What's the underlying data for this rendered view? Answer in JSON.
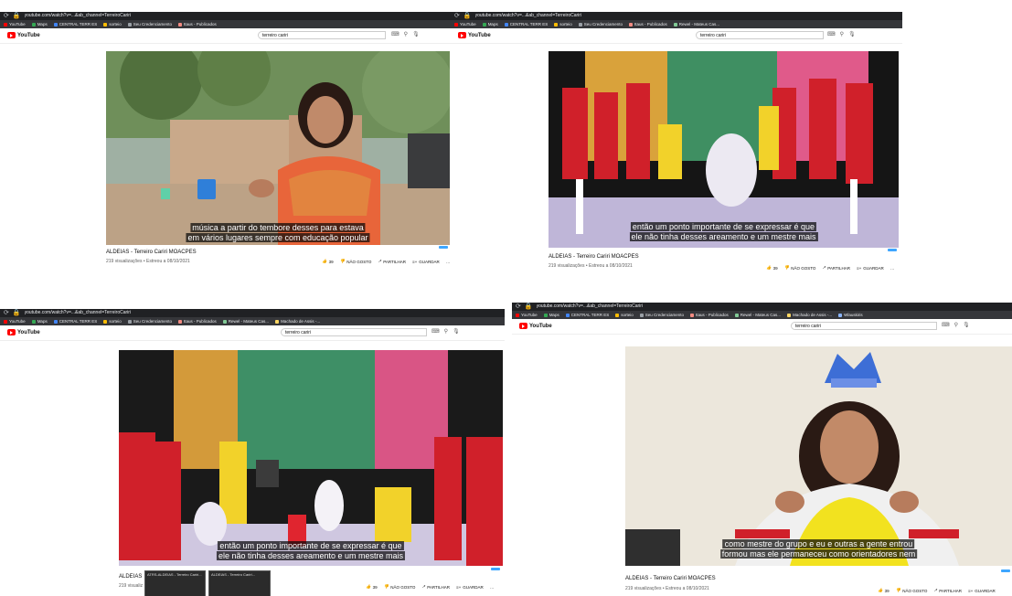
{
  "browser": {
    "url": "youtube.com/watch?v=...&ab_channel=TerreiroCariri",
    "bookmarks": [
      "YouTube",
      "Maps",
      "CENTRAL TERR ES",
      "sorteio",
      "Seu Credenciamento",
      "Itaus - Publicados",
      "Rewel - Mateus Cas...",
      "Machado de Assis -...",
      "Wlauskiris"
    ]
  },
  "youtube": {
    "logo": "YouTube",
    "search_value": "terreiro cariri"
  },
  "panels": [
    {
      "caption_lines": [
        "música a partir do tembore desses para estava",
        "em vários lugares sempre com educação popular"
      ],
      "title": "ALDEIAS - Terreiro Cariri MOACPES",
      "meta": "219 visualizações • Estreou a 08/10/2021"
    },
    {
      "caption_lines": [
        "então um ponto importante de se expressar é que",
        "ele não tinha desses areamento e um mestre mais"
      ],
      "title": "ALDEIAS - Terreiro Cariri MOACPES",
      "meta": "219 visualizações • Estreou a 08/10/2021"
    },
    {
      "caption_lines": [
        "então um ponto importante de se expressar é que",
        "ele não tinha desses areamento e um mestre mais"
      ],
      "title": "ALDEIAS",
      "meta": "219 visualiz",
      "taskbar": [
        "ATRS-ALDEIAS - Terreiro Cariri...",
        "ALDEIAS - Terreiro Cariri..."
      ]
    },
    {
      "caption_lines": [
        "como mestre do grupo e eu e outras a gente entrou",
        "formou mas ele permaneceu como orientadores nem"
      ],
      "title": "ALDEIAS - Terreiro Cariri MOACPES",
      "meta": "219 visualizações • Estreou a 08/10/2021"
    }
  ],
  "actions": {
    "likes": "39",
    "dislike": "NÃO GOSTO",
    "share": "PARTILHAR",
    "save": "GUARDAR"
  },
  "icons": [
    "back-icon",
    "reload-icon",
    "lock-icon",
    "keyboard-icon",
    "clear-icon",
    "search-icon",
    "mic-icon",
    "thumbs-up-icon",
    "thumbs-down-icon",
    "share-icon",
    "save-icon",
    "more-icon"
  ],
  "colors": {
    "yt_red": "#ff0000",
    "chrome_dark": "#202124",
    "bookmarks_bar": "#35363a"
  }
}
